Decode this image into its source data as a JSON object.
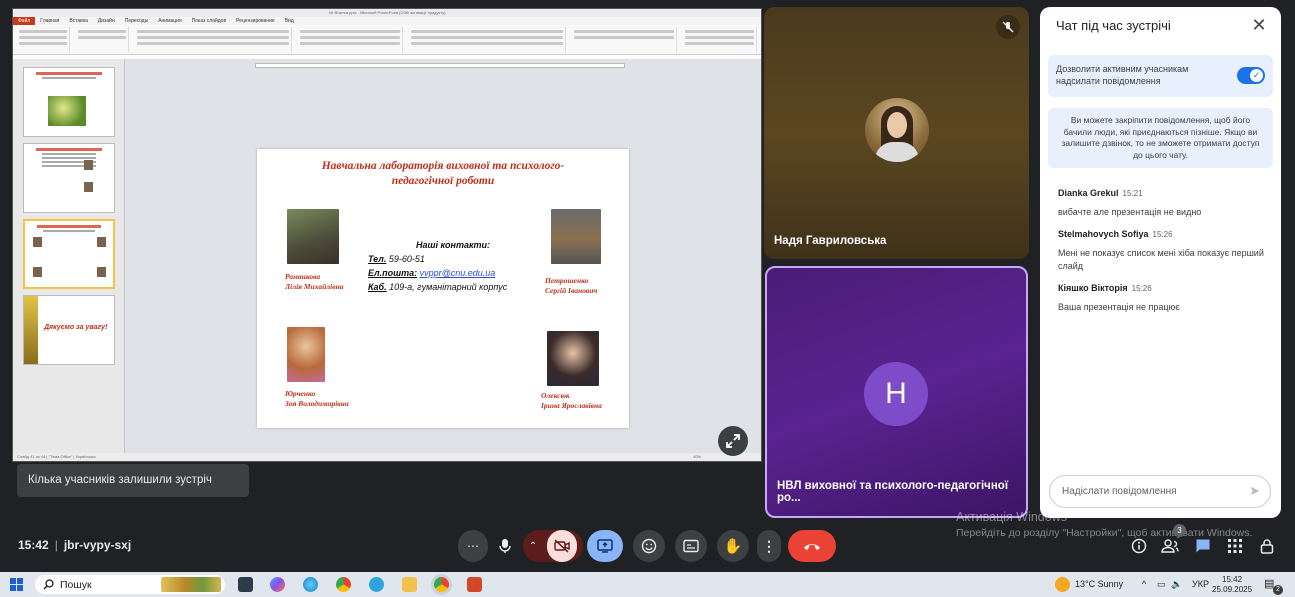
{
  "powerpoint": {
    "window_title": "XII Візитка.pptx - Microsoft PowerPoint (Сбій активації продукту)",
    "tabs": [
      "Файл",
      "Главная",
      "Вставка",
      "Дизайн",
      "Переходы",
      "Анимация",
      "Показ слайдов",
      "Рецензирование",
      "Вид"
    ],
    "panel_tabs": [
      "Слайды",
      "Структура"
    ],
    "status": "Слайд 41 из 44 | \"Тема Office\" | Українська",
    "zoom": "40%",
    "thumb_last_text": "Дякуємо за увагу!"
  },
  "slide": {
    "title": "Навчальна лабораторія виховної та психолого-педагогічної роботи",
    "contacts_heading": "Наші контакти:",
    "phone_label": "Тел.",
    "phone": "59-60-51",
    "email_label": "Ел.пошта:",
    "email": "vvppr@cnu.edu.ua",
    "office_label": "Каб.",
    "office": "109-а, гуманітарний корпус",
    "people": [
      {
        "name": "Романкова\nЛілія Михайлівна"
      },
      {
        "name": "Петрошенко\nСергій Іванович"
      },
      {
        "name": "Юрченко\nЗоя Володимирівна"
      },
      {
        "name": "Олексюк\nІрина Ярославівна"
      }
    ]
  },
  "notice": "Кілька учасників залишили зустріч",
  "tiles": {
    "participant1": "Надя Гавриловська",
    "participant2": "НВЛ виховної та психолого-педагогічної ро...",
    "participant2_initial": "H"
  },
  "chat": {
    "title": "Чат під час зустрічі",
    "allow_text": "Дозволити активним учасникам надсилати повідомлення",
    "pin_info": "Ви можете закріпити повідомлення, щоб його бачили люди, які приєднаються пізніше. Якщо ви залишите дзвінок, то не зможете отримати доступ до цього чату.",
    "messages": [
      {
        "author": "Dianka Grekul",
        "time": "15:21",
        "text": "вибачте але презентація не видно"
      },
      {
        "author": "Stelmahovych Sofiya",
        "time": "15:26",
        "text": "Мені не показує список мені хіба показує перший слайд"
      },
      {
        "author": "Кіяшко Вікторія",
        "time": "15:26",
        "text": "Ваша презентація не працює"
      }
    ],
    "input_placeholder": "Надіслати повідомлення"
  },
  "meeting": {
    "time": "15:42",
    "code": "jbr-vypy-sxj",
    "people_count": "3"
  },
  "watermark": {
    "line1": "Активація Windows",
    "line2": "Перейдіть до розділу \"Настройки\", щоб активувати Windows."
  },
  "taskbar": {
    "search_label": "Пошук",
    "weather": "13°C  Sunny",
    "lang": "УКР",
    "clock_time": "15:42",
    "clock_date": "25.09.2025",
    "notif_count": "2"
  },
  "colors": {
    "accent": "#1a73e8",
    "end_call": "#ea4335",
    "present_active": "#8ab4f8",
    "camera_off": "#f9dedc",
    "slide_red": "#c0301c",
    "tile_purple": "#7e4bc9"
  }
}
